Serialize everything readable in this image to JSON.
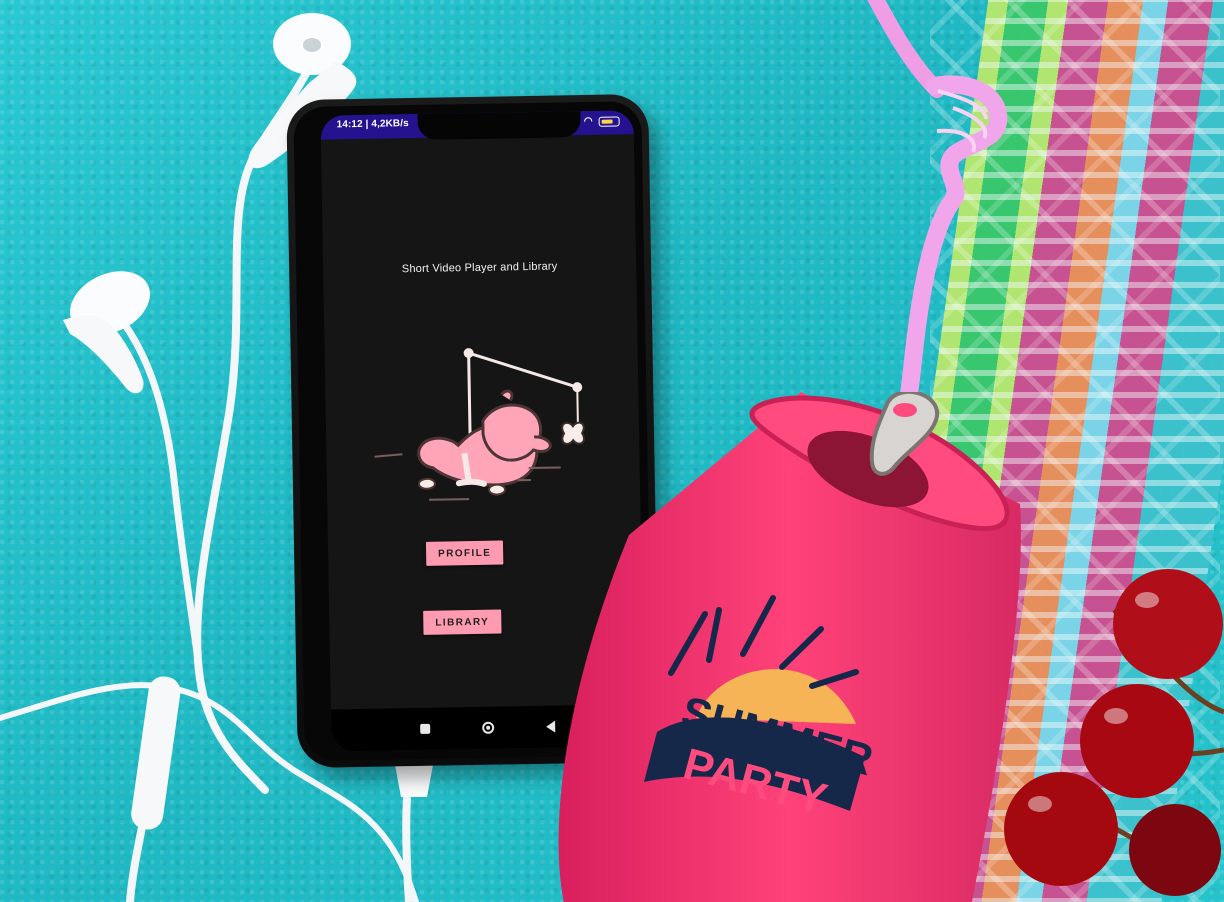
{
  "status_bar": {
    "time": "14:12 | 4,2KB/s"
  },
  "app": {
    "title": "Short Video Player and Library",
    "buttons": {
      "profile": "PROFILE",
      "library": "LIBRARY"
    }
  },
  "colors": {
    "status_bar": "#24128f",
    "screen_background": "#151515",
    "button_background": "#ff9bb1",
    "button_text": "#231f20",
    "can": "#f33b75",
    "towel": "#27bfca"
  },
  "icons": {
    "wifi": "wifi-icon",
    "battery": "battery-icon",
    "nav_recent": "square-icon",
    "nav_home": "home-circle-icon",
    "nav_back": "back-triangle-icon"
  },
  "can_logo": {
    "top_text": "SUMMER",
    "bottom_text": "PARTY"
  }
}
